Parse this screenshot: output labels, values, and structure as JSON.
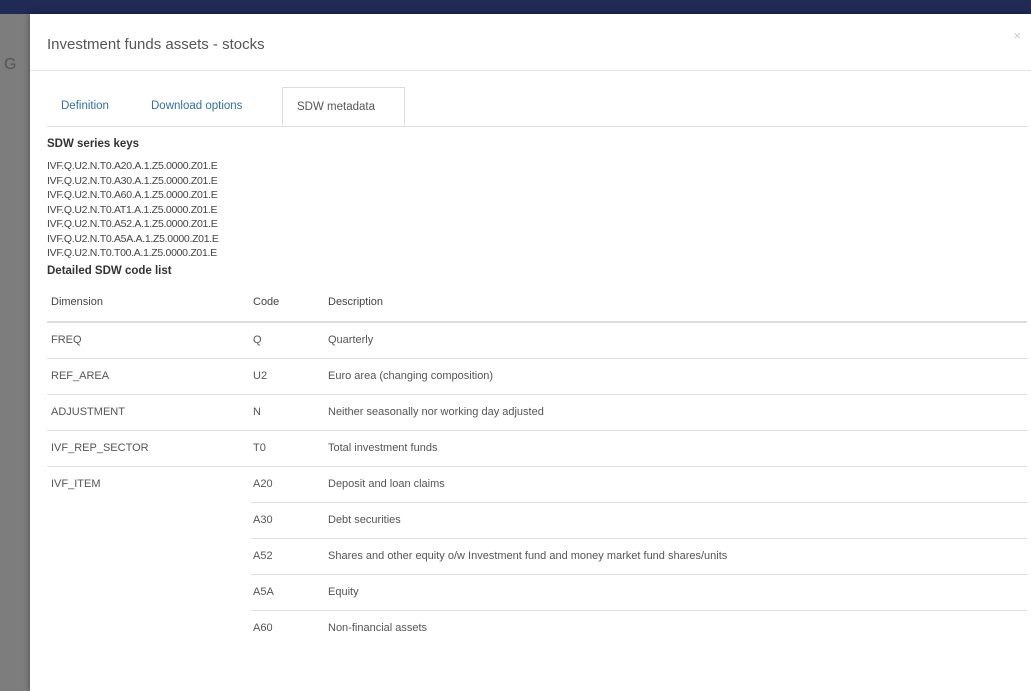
{
  "modal": {
    "title": "Investment funds assets - stocks",
    "close_label": "×"
  },
  "tabs": [
    {
      "label": "Definition"
    },
    {
      "label": "Download options"
    },
    {
      "label": "SDW metadata",
      "active": true
    }
  ],
  "series_keys_heading": "SDW series keys",
  "series_keys": [
    "IVF.Q.U2.N.T0.A20.A.1.Z5.0000.Z01.E",
    "IVF.Q.U2.N.T0.A30.A.1.Z5.0000.Z01.E",
    "IVF.Q.U2.N.T0.A60.A.1.Z5.0000.Z01.E",
    "IVF.Q.U2.N.T0.AT1.A.1.Z5.0000.Z01.E",
    "IVF.Q.U2.N.T0.A52.A.1.Z5.0000.Z01.E",
    "IVF.Q.U2.N.T0.A5A.A.1.Z5.0000.Z01.E",
    "IVF.Q.U2.N.T0.T00.A.1.Z5.0000.Z01.E"
  ],
  "code_list_heading": "Detailed SDW code list",
  "table": {
    "headers": [
      "Dimension",
      "Code",
      "Description"
    ],
    "rows": [
      {
        "dimension": "FREQ",
        "code": "Q",
        "description": "Quarterly"
      },
      {
        "dimension": "REF_AREA",
        "code": "U2",
        "description": "Euro area (changing composition)"
      },
      {
        "dimension": "ADJUSTMENT",
        "code": "N",
        "description": "Neither seasonally nor working day adjusted"
      },
      {
        "dimension": "IVF_REP_SECTOR",
        "code": "T0",
        "description": "Total investment funds"
      },
      {
        "dimension": "IVF_ITEM",
        "code": "A20",
        "description": "Deposit and loan claims"
      },
      {
        "dimension": "",
        "code": "A30",
        "description": "Debt securities"
      },
      {
        "dimension": "",
        "code": "A52",
        "description": "Shares and other equity o/w Investment fund and money market fund shares/units"
      },
      {
        "dimension": "",
        "code": "A5A",
        "description": "Equity"
      },
      {
        "dimension": "",
        "code": "A60",
        "description": "Non-financial assets"
      }
    ]
  }
}
